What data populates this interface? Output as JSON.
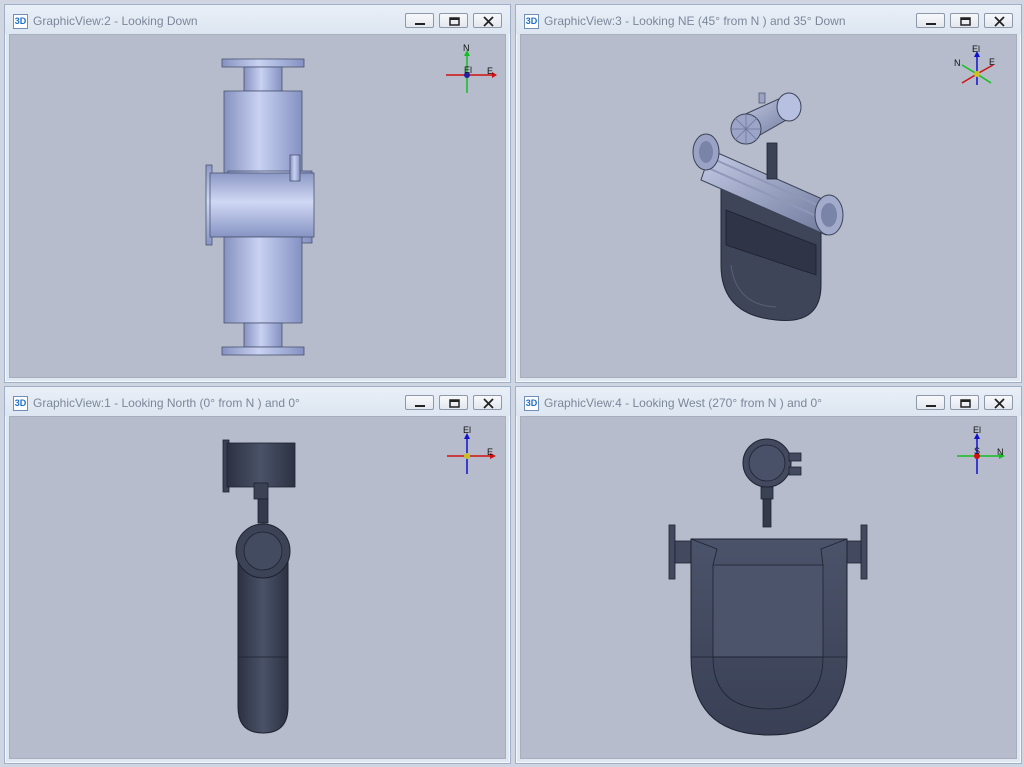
{
  "views": [
    {
      "title": "GraphicView:2 - Looking Down",
      "axes": {
        "up": "N",
        "right": "E",
        "center": "El"
      }
    },
    {
      "title": "GraphicView:3 - Looking NE (45° from N ) and 35° Down",
      "axes": {
        "up": "El",
        "left": "N",
        "right": "E"
      }
    },
    {
      "title": "GraphicView:1 - Looking North (0° from N ) and 0°",
      "axes": {
        "up": "El",
        "right": "E"
      }
    },
    {
      "title": "GraphicView:4 - Looking West (270° from N ) and 0°",
      "axes": {
        "up": "El",
        "right": "N",
        "center": "S"
      }
    }
  ],
  "app_icon_label": "3D",
  "colors": {
    "frame": "#dfe7f2",
    "viewport": "#b6bccb",
    "model_light": "#a9b6e2",
    "model_dark": "#3a4256",
    "axis_x": "#d01010",
    "axis_y": "#10c020",
    "axis_z": "#1010d0"
  }
}
